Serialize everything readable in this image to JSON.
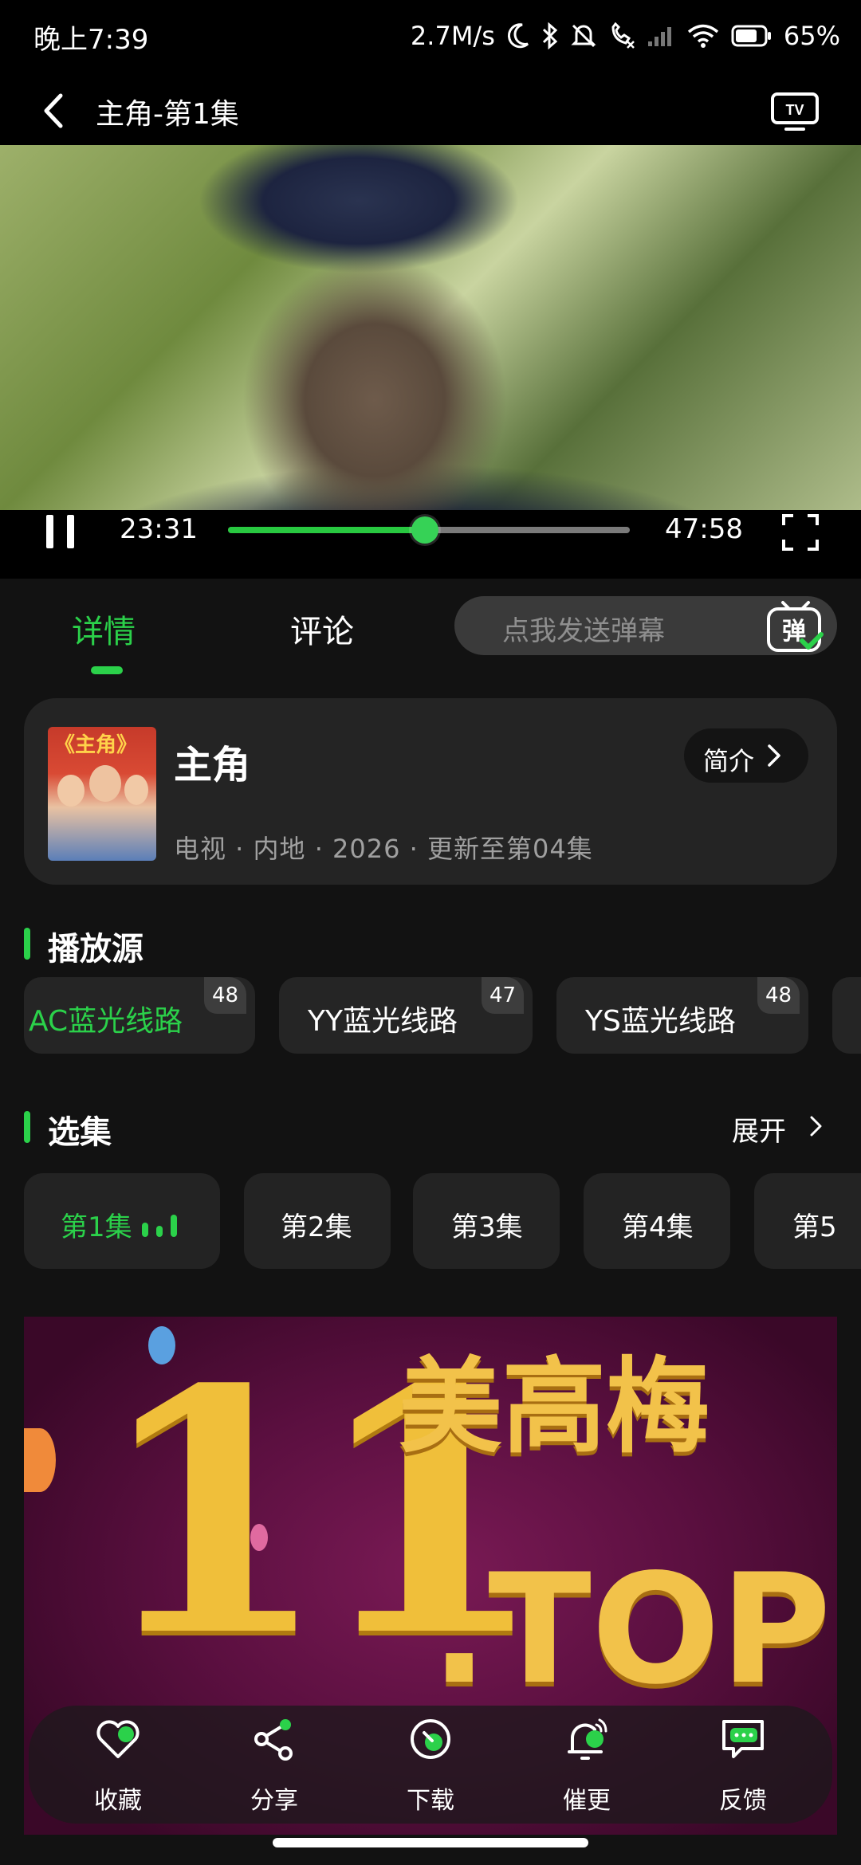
{
  "status_bar": {
    "time": "晚上7:39",
    "network_speed": "2.7M/s",
    "battery_percent": "65%"
  },
  "header": {
    "title": "主角-第1集"
  },
  "player": {
    "current_time": "23:31",
    "total_time": "47:58",
    "progress_fraction": 0.49
  },
  "tabs": {
    "details": "详情",
    "comments": "评论"
  },
  "danmu": {
    "placeholder": "点我发送弹幕",
    "icon_char": "弹"
  },
  "show": {
    "poster_text": "《主角》",
    "title": "主角",
    "intro_label": "简介",
    "meta": "电视 · 内地 · 2026 · 更新至第04集"
  },
  "sources": {
    "title": "播放源",
    "items": [
      {
        "label": "AC蓝光线路",
        "count": "48",
        "active": true
      },
      {
        "label": "YY蓝光线路",
        "count": "47",
        "active": false
      },
      {
        "label": "YS蓝光线路",
        "count": "48",
        "active": false
      }
    ]
  },
  "episodes": {
    "title": "选集",
    "expand_label": "展开",
    "items": [
      "第1集",
      "第2集",
      "第3集",
      "第4集",
      "第5"
    ]
  },
  "ad": {
    "number": "11",
    "name": "美高梅",
    "domain": ".TOP"
  },
  "actions": {
    "favorite": "收藏",
    "share": "分享",
    "download": "下载",
    "urge_update": "催更",
    "feedback": "反馈"
  },
  "colors": {
    "accent": "#2bd14a",
    "background": "#121212",
    "card": "#242424"
  }
}
